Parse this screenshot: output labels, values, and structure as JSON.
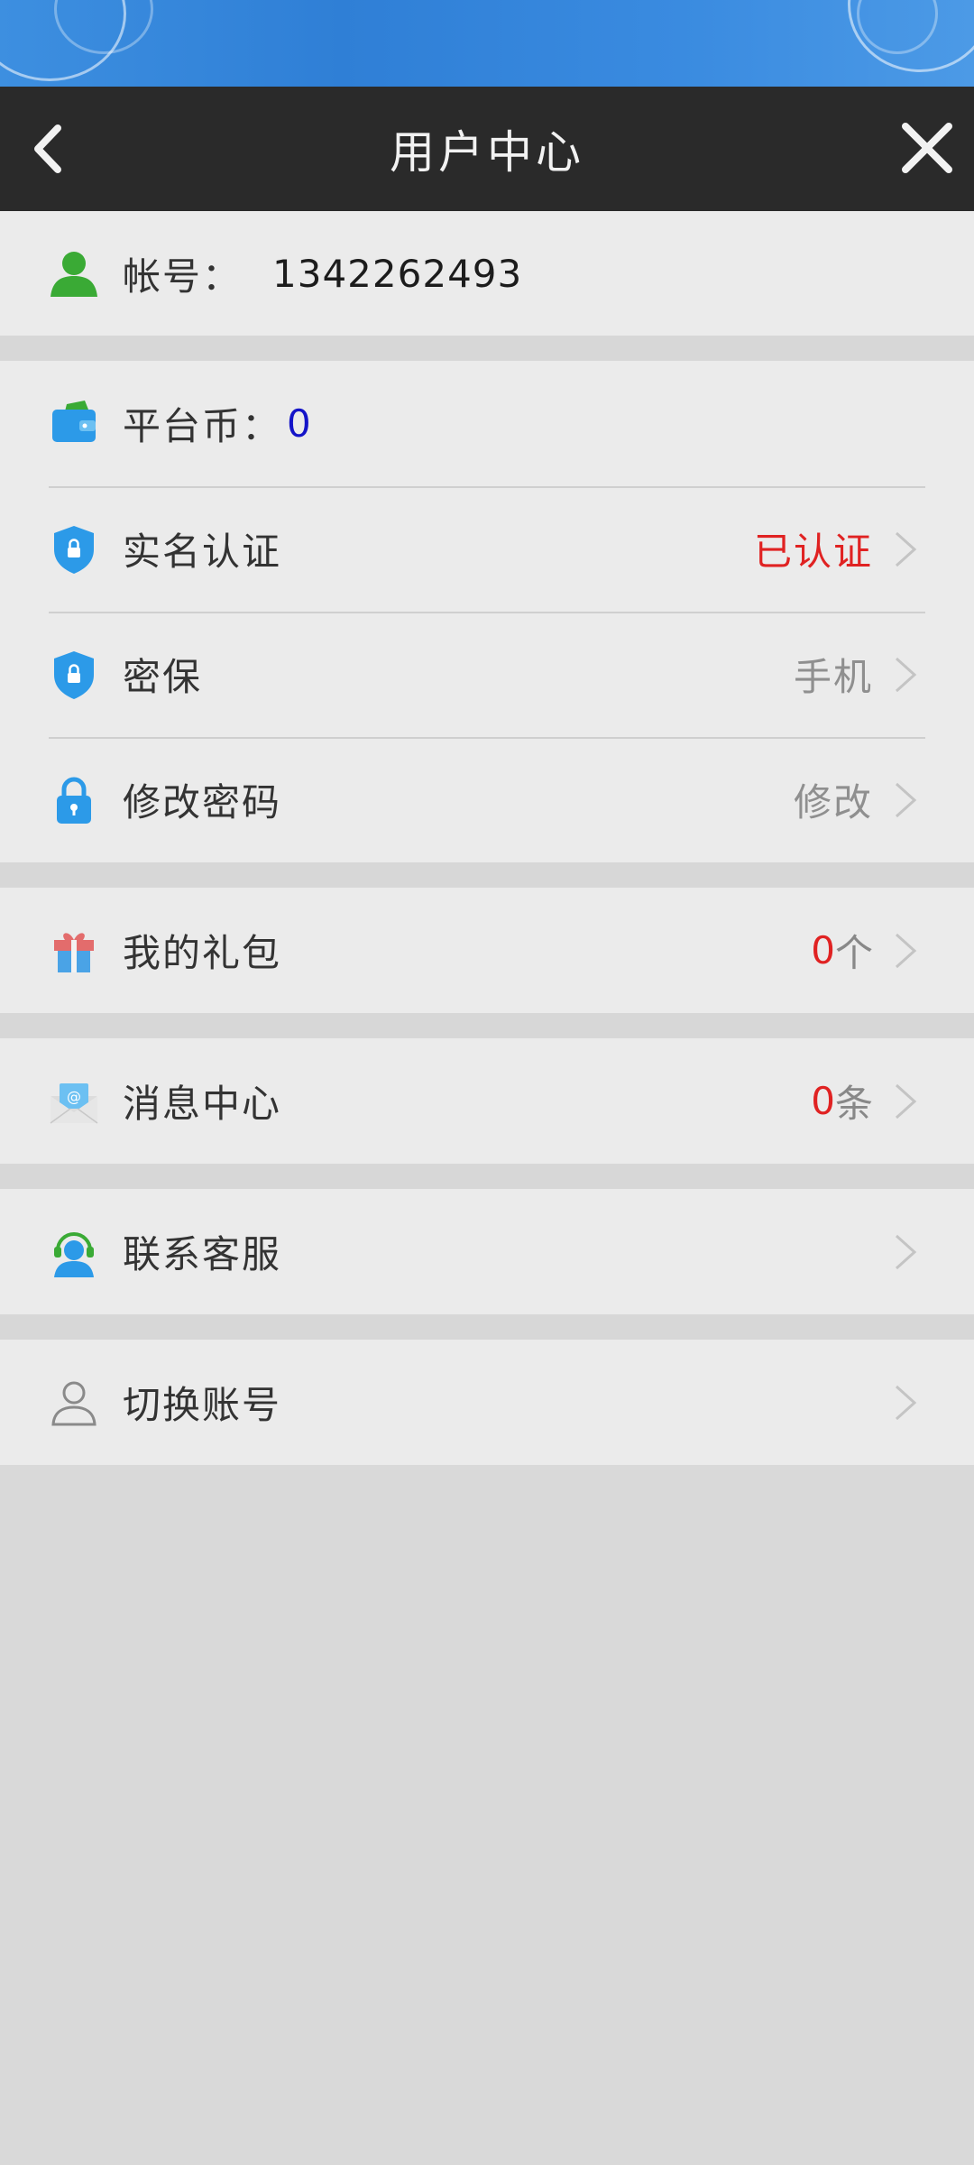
{
  "header": {
    "title": "用户中心"
  },
  "account": {
    "label": "帐号：",
    "value": "1342262493"
  },
  "coins": {
    "label": "平台币：",
    "value": "0"
  },
  "verify": {
    "label": "实名认证",
    "status": "已认证"
  },
  "security": {
    "label": "密保",
    "status": "手机"
  },
  "password": {
    "label": "修改密码",
    "status": "修改"
  },
  "gifts": {
    "label": "我的礼包",
    "count": "0",
    "unit": "个"
  },
  "messages": {
    "label": "消息中心",
    "count": "0",
    "unit": "条"
  },
  "support": {
    "label": "联系客服"
  },
  "switch_account": {
    "label": "切换账号"
  },
  "colors": {
    "header_bg": "#2a2a2a",
    "accent_red": "#e02222",
    "accent_blue": "#1414c8",
    "icon_blue": "#2c9ae8",
    "icon_green": "#3aaa35"
  },
  "icons": [
    "back-arrow-icon",
    "close-icon",
    "user-icon",
    "wallet-icon",
    "shield-lock-icon",
    "padlock-icon",
    "gift-icon",
    "mail-icon",
    "customer-service-icon",
    "person-outline-icon",
    "chevron-right-icon"
  ]
}
